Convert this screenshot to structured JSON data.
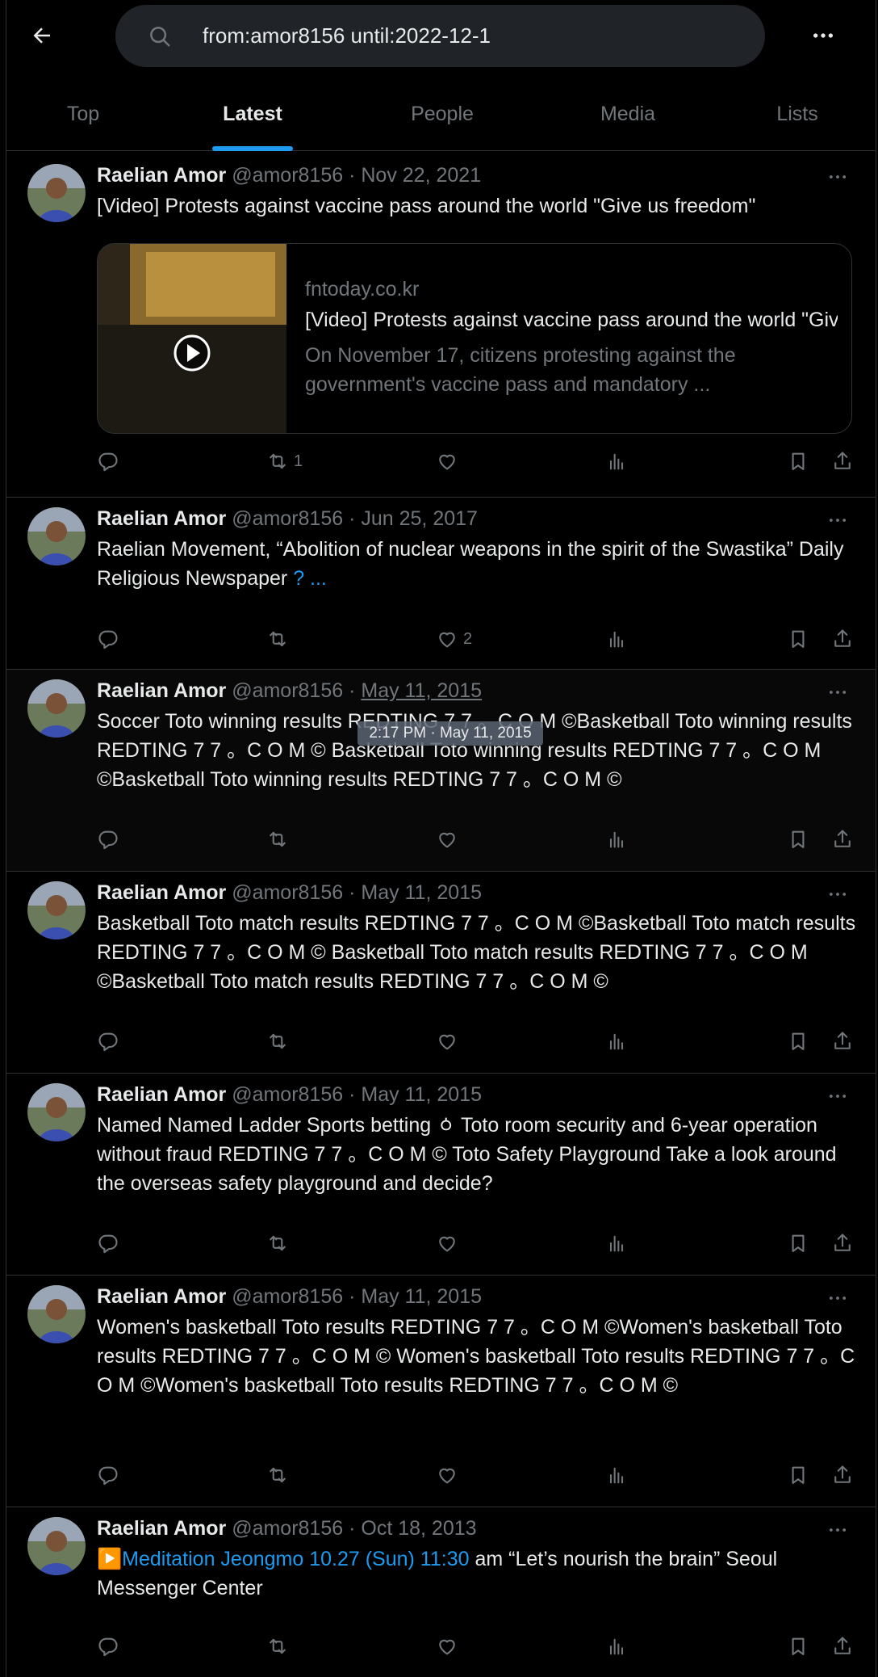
{
  "search": {
    "query": "from:amor8156 until:2022-12-1"
  },
  "tabs": [
    {
      "label": "Top",
      "active": false
    },
    {
      "label": "Latest",
      "active": true
    },
    {
      "label": "People",
      "active": false
    },
    {
      "label": "Media",
      "active": false
    },
    {
      "label": "Lists",
      "active": false
    }
  ],
  "colors": {
    "background": "#000000",
    "accent": "#1d9bf0",
    "muted": "#71767b",
    "text": "#e7e9ea"
  },
  "tweets": [
    {
      "author": "Raelian Amor",
      "handle": "@amor8156",
      "sep": "·",
      "date": "Nov 22, 2021",
      "text": "[Video] Protests against vaccine pass around the world \"Give us freedom\"",
      "card": {
        "domain": "fntoday.co.kr",
        "title": "[Video] Protests against vaccine pass around the world \"Give us freedom\"",
        "description": "On November 17, citizens protesting against the government's vaccine pass and mandatory ..."
      },
      "retweets": "1",
      "likes": ""
    },
    {
      "author": "Raelian Amor",
      "handle": "@amor8156",
      "sep": "·",
      "date": "Jun 25, 2017",
      "text_prefix": "Raelian Movement, “Abolition of nuclear weapons in the spirit of the Swastika” Daily Religious Newspaper ",
      "text_link": " ? ...",
      "retweets": "",
      "likes": "2"
    },
    {
      "author": "Raelian Amor",
      "handle": "@amor8156",
      "sep": "·",
      "date": "May 11, 2015",
      "text": "Soccer Toto winning results REDTING 7 7 。C O M ©Basketball Toto winning results REDTING 7 7 。C O M © Basketball Toto winning results REDTING 7 7 。C O M ©Basketball Toto winning results REDTING 7 7 。C O M ©",
      "tooltip": "2:17 PM · May 11, 2015",
      "retweets": "",
      "likes": ""
    },
    {
      "author": "Raelian Amor",
      "handle": "@amor8156",
      "sep": "·",
      "date": "May 11, 2015",
      "text": "Basketball Toto match results REDTING 7 7 。C O M ©Basketball Toto match results REDTING 7 7 。C O M © Basketball Toto match results REDTING 7 7 。C O M ©Basketball Toto match results REDTING 7 7 。C O M ©",
      "retweets": "",
      "likes": ""
    },
    {
      "author": "Raelian Amor",
      "handle": "@amor8156",
      "sep": "·",
      "date": "May 11, 2015",
      "text": "Named Named Ladder Sports betting ㆁ Toto room security and 6-year operation without fraud REDTING 7 7 。C O M © Toto Safety Playground Take a look around the overseas safety playground and decide?",
      "retweets": "",
      "likes": ""
    },
    {
      "author": "Raelian Amor",
      "handle": "@amor8156",
      "sep": "·",
      "date": "May 11, 2015",
      "text": "Women's basketball Toto results REDTING 7 7 。C O M ©Women's basketball Toto results REDTING 7 7 。C O M © Women's basketball Toto results REDTING 7 7 。C O M ©Women's basketball Toto results REDTING 7 7 。C O M ©",
      "retweets": "",
      "likes": ""
    },
    {
      "author": "Raelian Amor",
      "handle": "@amor8156",
      "sep": "·",
      "date": "Oct 18, 2013",
      "text_link": "▶️Meditation Jeongmo 10.27 (Sun) 11:30",
      "text_suffix": " am “Let’s nourish the brain” Seoul Messenger Center",
      "retweets": "",
      "likes": ""
    }
  ]
}
